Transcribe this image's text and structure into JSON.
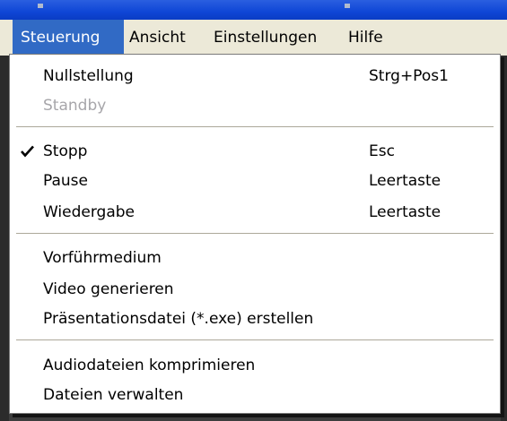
{
  "menubar": {
    "items": [
      {
        "label": "Steuerung",
        "active": true
      },
      {
        "label": "Ansicht",
        "active": false
      },
      {
        "label": "Einstellungen",
        "active": false
      },
      {
        "label": "Hilfe",
        "active": false
      }
    ]
  },
  "menu": {
    "groups": [
      {
        "items": [
          {
            "label": "Nullstellung",
            "shortcut": "Strg+Pos1",
            "enabled": true,
            "checked": false
          },
          {
            "label": "Standby",
            "shortcut": "",
            "enabled": false,
            "checked": false
          }
        ]
      },
      {
        "items": [
          {
            "label": "Stopp",
            "shortcut": "Esc",
            "enabled": true,
            "checked": true
          },
          {
            "label": "Pause",
            "shortcut": "Leertaste",
            "enabled": true,
            "checked": false
          },
          {
            "label": "Wiedergabe",
            "shortcut": "Leertaste",
            "enabled": true,
            "checked": false
          }
        ]
      },
      {
        "items": [
          {
            "label": "Vorführmedium",
            "shortcut": "",
            "enabled": true,
            "checked": false
          },
          {
            "label": "Video generieren",
            "shortcut": "",
            "enabled": true,
            "checked": false
          },
          {
            "label": "Präsentationsdatei (*.exe) erstellen",
            "shortcut": "",
            "enabled": true,
            "checked": false
          }
        ]
      },
      {
        "items": [
          {
            "label": "Audiodateien komprimieren",
            "shortcut": "",
            "enabled": true,
            "checked": false
          },
          {
            "label": "Dateien verwalten",
            "shortcut": "",
            "enabled": true,
            "checked": false
          }
        ]
      }
    ]
  },
  "colors": {
    "highlight": "#316ac5",
    "menubar_bg": "#ece9d8",
    "disabled_text": "#a7a6aa",
    "titlebar": "#0f46d6"
  },
  "icons": {
    "check": "checkmark-icon"
  }
}
